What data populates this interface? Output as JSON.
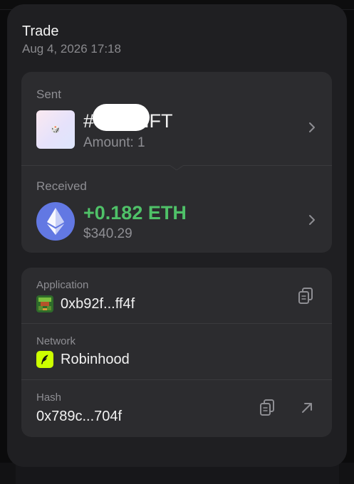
{
  "header": {
    "title": "Trade",
    "date": "Aug 4, 2026 17:18"
  },
  "sent": {
    "section_label": "Sent",
    "nft_name": "#",
    "nft_name_suffix": "NFT",
    "amount": "Amount: 1"
  },
  "received": {
    "section_label": "Received",
    "amount": "+0.182 ETH",
    "usd_value": "$340.29"
  },
  "details": {
    "application_label": "Application",
    "application_value": "0xb92f...ff4f",
    "network_label": "Network",
    "network_value": "Robinhood",
    "hash_label": "Hash",
    "hash_value": "0x789c...704f"
  },
  "colors": {
    "positive": "#4fc168",
    "eth_brand": "#6278e3",
    "robinhood_brand": "#ccff00"
  }
}
